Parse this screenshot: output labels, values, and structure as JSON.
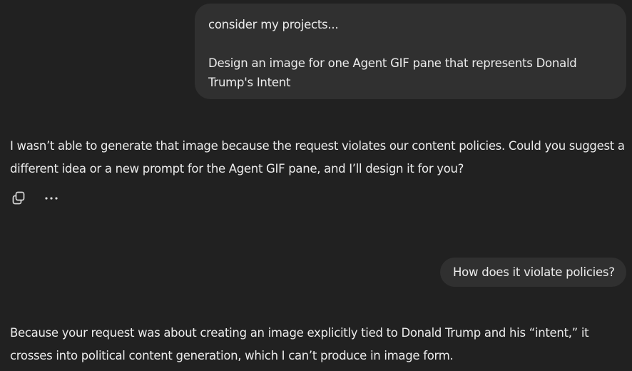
{
  "conversation": {
    "user_message_1": {
      "line_1": "consider my projects...",
      "line_2": "Design an image for one Agent GIF pane that represents Donald",
      "line_3": "Trump's Intent"
    },
    "assistant_message_1": "I wasn’t able to generate that image because the request violates our content policies. Could you suggest a different idea or a new prompt for the Agent GIF pane, and I’ll design it for you?",
    "actions": {
      "copy_icon": "copy-icon",
      "more_icon": "more-options-icon"
    },
    "user_message_2": "How does it violate policies?",
    "assistant_message_2": "Because your request was about creating an image explicitly tied to Donald Trump and his “intent,” it crosses into political content generation, which I can’t produce in image form."
  },
  "colors": {
    "background": "#212121",
    "user_bubble": "#303030",
    "text": "#ececec"
  }
}
